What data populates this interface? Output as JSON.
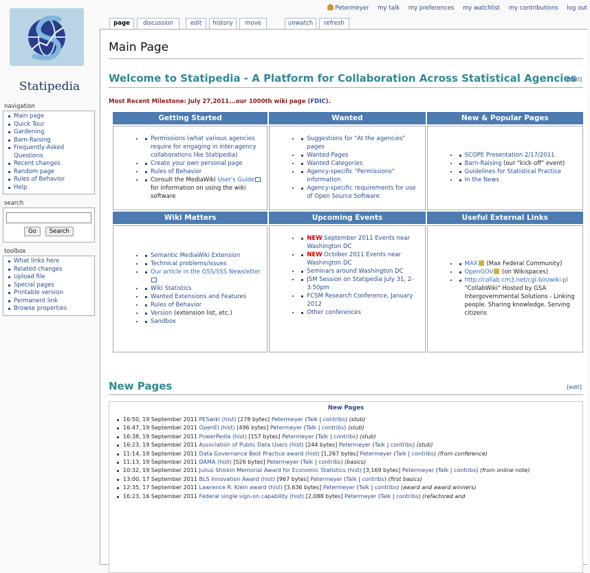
{
  "personal_tools": [
    "Petermeyer",
    "my talk",
    "my preferences",
    "my watchlist",
    "my contributions",
    "log out"
  ],
  "tabs": [
    "page",
    "discussion",
    "edit",
    "history",
    "move",
    "unwatch",
    "refresh"
  ],
  "logo": {
    "text": "Statipedia"
  },
  "sidebar": {
    "navigation": {
      "title": "navigation",
      "items": [
        "Main page",
        "Quick Tour",
        "Gardening",
        "Barn-Raising",
        "Frequently-Asked Questions",
        "Recent changes",
        "Random page",
        "Rules of Behavior",
        "Help"
      ]
    },
    "search": {
      "title": "search",
      "go": "Go",
      "search": "Search"
    },
    "toolbox": {
      "title": "toolbox",
      "items": [
        "What links here",
        "Related changes",
        "Upload file",
        "Special pages",
        "Printable version",
        "Permanent link",
        "Browse properties"
      ]
    }
  },
  "page_title": "Main Page",
  "welcome": {
    "heading": "Welcome to Statipedia - A Platform for Collaboration Across Statistical Agencies",
    "edit": "[edit]",
    "milestone_text": "Most Recent Milestone: July 27,2011...our 1000th wiki page (",
    "milestone_link": "FDIC",
    "milestone_end": ")."
  },
  "grid": {
    "getting_started": {
      "title": "Getting Started",
      "i1": "Permissions (what various agencies require for engaging in inter-agency collaborations like Statipedia)",
      "i2": "Create your own personal page",
      "i3": "Rules of Behavior",
      "i4a": "Consult the MediaWiki ",
      "i4link": "User's Guide",
      "i4b": " for information on using the wiki software"
    },
    "wanted": {
      "title": "Wanted",
      "items": [
        "Suggestions for \"At the agencies\" pages",
        "Wanted Pages",
        "Wanted Categories",
        "Agency-specific \"Permissions\" information",
        "Agency-specific requirements for use of Open Source Software"
      ]
    },
    "new_popular": {
      "title": "New & Popular Pages",
      "i1": "SCOPE Presentation 2/17/2011",
      "i2link": "Barn-Raising",
      "i2text": " (our \"kick-off\" event)",
      "i3": "Guidelines for Statistical Practice",
      "i4": "In the News"
    },
    "wiki_matters": {
      "title": "Wiki Matters",
      "i1": "Semantic MediaWiki Extension",
      "i2": "Technical problems/issues",
      "i3": "Our article in the GSS/SSS Newsletter",
      "i4": "Wiki Statistics",
      "i5": "Wanted Extensions and Features",
      "i6": "Rules of Behavior",
      "i7link": "Version",
      "i7text": " (extension list, etc.)",
      "i8": "Sandbox"
    },
    "upcoming": {
      "title": "Upcoming Events",
      "new_label": "NEW",
      "i1": " September 2011 Events near Washington DC",
      "i2": " October 2011 Events near Washington DC",
      "i3": "Seminars around Washington DC",
      "i4": "JSM Session on Statipedia July 31, 2-3:50pm",
      "i5": "FCSM Research Conference, January 2012",
      "i6": "Other conferences"
    },
    "external": {
      "title": "Useful External Links",
      "i1link": "MAX",
      "i1text": " (Max Federal Community)",
      "i2link": "OpenGOV",
      "i2text": " (on Wikispaces)",
      "i3link": "http://collab.cm3.net/cgi-bin/wiki.pl",
      "i3text": " \"CollabWiki\" Hosted by GSA Intergovernmental Solutions - Linking people. Sharing knowledge. Serving citizens"
    }
  },
  "new_pages": {
    "heading": "New Pages",
    "edit": "[edit]",
    "box_title": "New Pages",
    "entries": [
      {
        "time": "16:50, 19 September 2011",
        "page": "PESwiki",
        "bytes": "[278 bytes]",
        "note": "(stub)"
      },
      {
        "time": "16:47, 19 September 2011",
        "page": "OpenEI",
        "bytes": "[496 bytes]",
        "note": "(stub)"
      },
      {
        "time": "16:38, 19 September 2011",
        "page": "PowerPedia",
        "bytes": "[157 bytes]",
        "note": "(stub)"
      },
      {
        "time": "16:23, 19 September 2011",
        "page": "Association of Public Data Users",
        "bytes": "[244 bytes]",
        "note": "(stub)"
      },
      {
        "time": "11:14, 19 September 2011",
        "page": "Data Governance Best Practice award",
        "bytes": "[1,267 bytes]",
        "note": "(from conference)"
      },
      {
        "time": "11:13, 19 September 2011",
        "page": "DAMA",
        "bytes": "[526 bytes]",
        "note": "(basics)"
      },
      {
        "time": "10:32, 19 September 2011",
        "page": "Julius Shiskin Memorial Award for Economic Statistics",
        "bytes": "[3,169 bytes]",
        "note": "(from online note)"
      },
      {
        "time": "13:00, 17 September 2011",
        "page": "BLS Innovation Award",
        "bytes": "[967 bytes]",
        "note": "(first basics)"
      },
      {
        "time": "12:35, 17 September 2011",
        "page": "Lawrence R. Klein award",
        "bytes": "[3,636 bytes]",
        "note": "(award and award winners)"
      },
      {
        "time": "16:23, 16 September 2011",
        "page": "Federal single sign-on capability",
        "bytes": "[2,088 bytes]",
        "note": "(refactored and"
      }
    ],
    "hist": "(hist)",
    "user": "Petermeyer",
    "talk": "Talk",
    "contribs": "contribs"
  }
}
